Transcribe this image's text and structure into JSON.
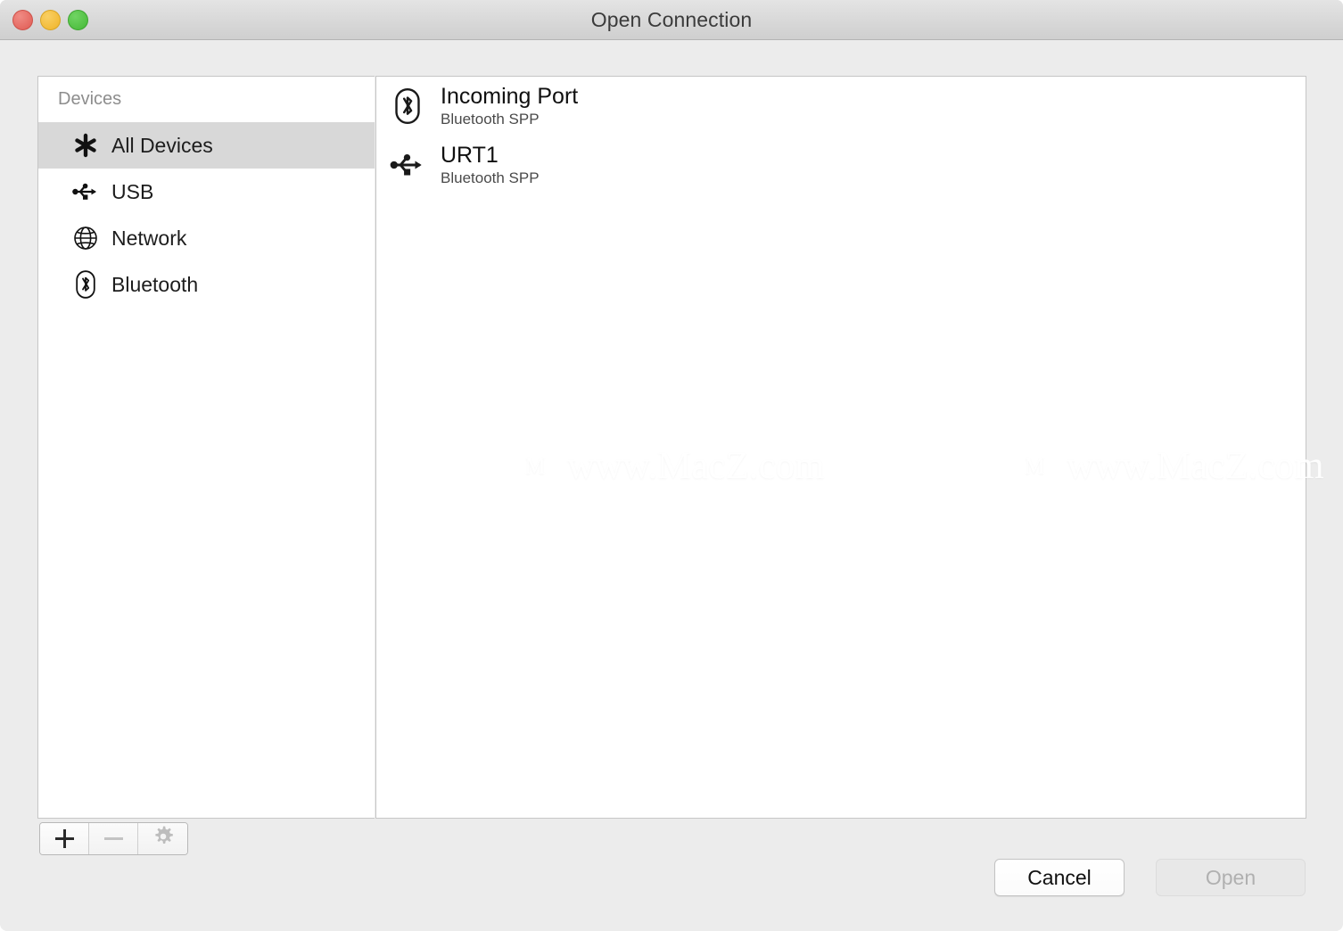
{
  "window": {
    "title": "Open Connection",
    "traffic_lights": [
      {
        "name": "close",
        "color": "#e05b53"
      },
      {
        "name": "minimize",
        "color": "#f0b429"
      },
      {
        "name": "maximize",
        "color": "#45b836"
      }
    ]
  },
  "sidebar": {
    "header": "Devices",
    "items": [
      {
        "label": "All Devices",
        "icon": "asterisk-icon",
        "selected": true
      },
      {
        "label": "USB",
        "icon": "usb-icon",
        "selected": false
      },
      {
        "label": "Network",
        "icon": "globe-icon",
        "selected": false
      },
      {
        "label": "Bluetooth",
        "icon": "bluetooth-icon",
        "selected": false
      }
    ]
  },
  "device_list": {
    "rows": [
      {
        "title": "Incoming Port",
        "subtitle": "Bluetooth SPP",
        "icon": "bluetooth-icon"
      },
      {
        "title": "URT1",
        "subtitle": "Bluetooth SPP",
        "icon": "usb-icon"
      }
    ]
  },
  "watermarks": [
    {
      "logo": "M",
      "text": "www.MacZ.com"
    },
    {
      "logo": "M",
      "text": "www.MacZ.com"
    }
  ],
  "toolbar": {
    "add_label": "+",
    "remove_label": "—",
    "settings_label": "gear-icon",
    "add_enabled": true,
    "remove_enabled": false,
    "settings_enabled": false
  },
  "footer": {
    "cancel_label": "Cancel",
    "open_label": "Open",
    "open_enabled": false
  },
  "colors": {
    "window_background": "#ececec",
    "titlebar": "#d8d8d8",
    "panel_background": "#ffffff",
    "selection": "#d8d8d8",
    "border": "#c6c6c6",
    "text_primary": "#101010",
    "text_secondary": "#8d8d8d",
    "disabled_text": "#b0b0b0"
  }
}
